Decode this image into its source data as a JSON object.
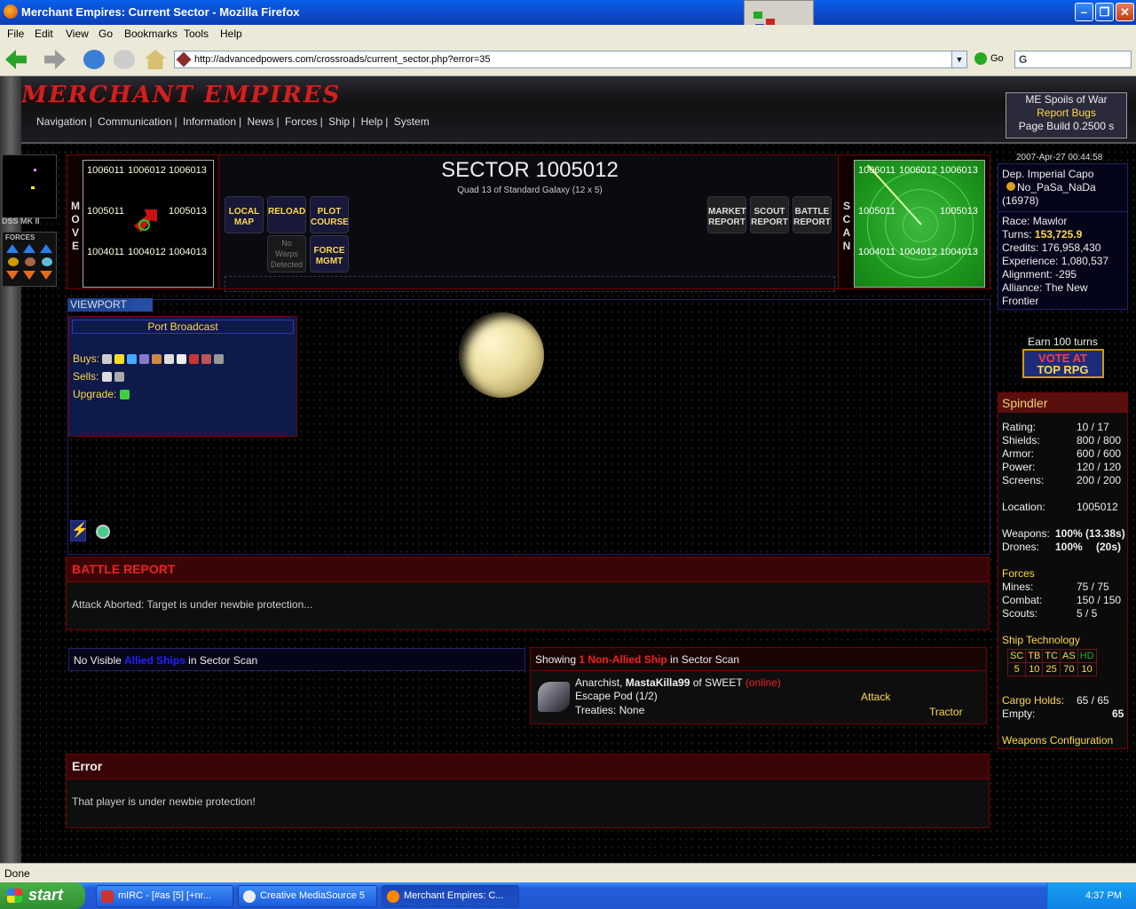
{
  "window": {
    "title": "Merchant Empires: Current Sector - Mozilla Firefox"
  },
  "menubar": [
    "File",
    "Edit",
    "View",
    "Go",
    "Bookmarks",
    "Tools",
    "Help"
  ],
  "toolbar": {
    "url": "http://advancedpowers.com/crossroads/current_sector.php?error=35",
    "go": "Go",
    "search": "G"
  },
  "game": {
    "logo": "MERCHANT EMPIRES",
    "nav": [
      "Navigation",
      "Communication",
      "Information",
      "News",
      "Forces",
      "Ship",
      "Help",
      "System"
    ],
    "topright": {
      "line1": "ME Spoils of War",
      "line2": "Report Bugs",
      "line3": "Page Build 0.2500 s"
    },
    "ship_label": "DSS MK II",
    "forces_label": "FORCES",
    "move": {
      "word": "MOVE",
      "cells": {
        "nw": "1006011",
        "n": "1006012",
        "ne": "1006013",
        "w": "1005011",
        "e": "1005013",
        "sw": "1004011",
        "s": "1004012",
        "se": "1004013"
      }
    },
    "sector": {
      "title": "SECTOR 1005012",
      "subtitle": "Quad 13 of Standard Galaxy (12 x 5)"
    },
    "buttons": {
      "local_map": [
        "LOCAL",
        "MAP"
      ],
      "reload": [
        "RELOAD",
        ""
      ],
      "plot_course": [
        "PLOT",
        "COURSE"
      ],
      "no_warps": [
        "No",
        "Warps",
        "Detected"
      ],
      "force_mgmt": [
        "FORCE",
        "MGMT"
      ],
      "market": [
        "MARKET",
        "REPORT"
      ],
      "scout": [
        "SCOUT",
        "REPORT"
      ],
      "battle": [
        "BATTLE",
        "REPORT"
      ]
    },
    "scan": {
      "word": "SCAN",
      "cells": {
        "nw": "1006011",
        "n": "1006012",
        "ne": "1006013",
        "w": "1005011",
        "e": "1005013",
        "sw": "1004011",
        "s": "1004012",
        "se": "1004013"
      }
    },
    "timestamp": "2007-Apr-27 00:44:58",
    "character": {
      "rank": "Dep. Imperial Capo",
      "name": "No_PaSa_NaDa",
      "id": "(16978)",
      "race_label": "Race:",
      "race": "Mawlor",
      "turns_label": "Turns:",
      "turns": "153,725.9",
      "credits_label": "Credits:",
      "credits": "176,958,430",
      "exp_label": "Experience:",
      "exp": "1,080,537",
      "align_label": "Alignment:",
      "align": "-295",
      "alliance_label": "Alliance:",
      "alliance": "The New Frontier"
    },
    "vote": {
      "label": "Earn 100 turns",
      "btn1": "VOTE AT",
      "btn2": "TOP RPG"
    },
    "ship": {
      "name": "Spindler",
      "rating_l": "Rating:",
      "rating": "10 / 17",
      "shields_l": "Shields:",
      "shields": "800 / 800",
      "armor_l": "Armor:",
      "armor": "600 / 600",
      "power_l": "Power:",
      "power": "120 / 120",
      "screens_l": "Screens:",
      "screens": "200 / 200",
      "location_l": "Location:",
      "location": "1005012",
      "weapons_l": "Weapons:",
      "weapons": "100%",
      "weapons_t": "(13.38s)",
      "drones_l": "Drones:",
      "drones": "100%",
      "drones_t": "(20s)",
      "forces_h": "Forces",
      "mines_l": "Mines:",
      "mines": "75 / 75",
      "combat_l": "Combat:",
      "combat": "150 / 150",
      "scouts_l": "Scouts:",
      "scouts": "5 / 5",
      "tech_h": "Ship Technology",
      "tech": [
        {
          "k": "SC",
          "v": "5"
        },
        {
          "k": "TB",
          "v": "10"
        },
        {
          "k": "TC",
          "v": "25"
        },
        {
          "k": "AS",
          "v": "70"
        },
        {
          "k": "HD",
          "v": "10"
        }
      ],
      "cargo_l": "Cargo Holds:",
      "cargo": "65 / 65",
      "empty_l": "Empty:",
      "empty": "65",
      "weapons_cfg": "Weapons Configuration"
    },
    "viewport": {
      "tab": "VIEWPORT",
      "port_title": "Port Broadcast",
      "buys": "Buys:",
      "sells": "Sells:",
      "upgrade": "Upgrade:"
    },
    "battle_report": {
      "title": "BATTLE REPORT",
      "text": "Attack Aborted: Target is under newbie protection..."
    },
    "allied": {
      "pre": "No Visible ",
      "link": "Allied Ships",
      "post": " in Sector Scan"
    },
    "nonallied": {
      "pre": "Showing ",
      "link": "1 Non-Allied Ship",
      "post": " in Sector Scan",
      "race": "Anarchist, ",
      "player": "MastaKilla99",
      "of": " of SWEET ",
      "online": "(online)",
      "ship": "Escape Pod (1/2)",
      "treaties": "Treaties: None",
      "attack": "Attack",
      "tractor": "Tractor"
    },
    "error": {
      "title": "Error",
      "text": "That player is under newbie protection!"
    }
  },
  "statusbar": "Done",
  "taskbar": {
    "start": "start",
    "tasks": [
      "mIRC - [#as [5] [+nr...",
      "Creative MediaSource 5",
      "Merchant Empires: C..."
    ],
    "clock": "4:37 PM"
  }
}
